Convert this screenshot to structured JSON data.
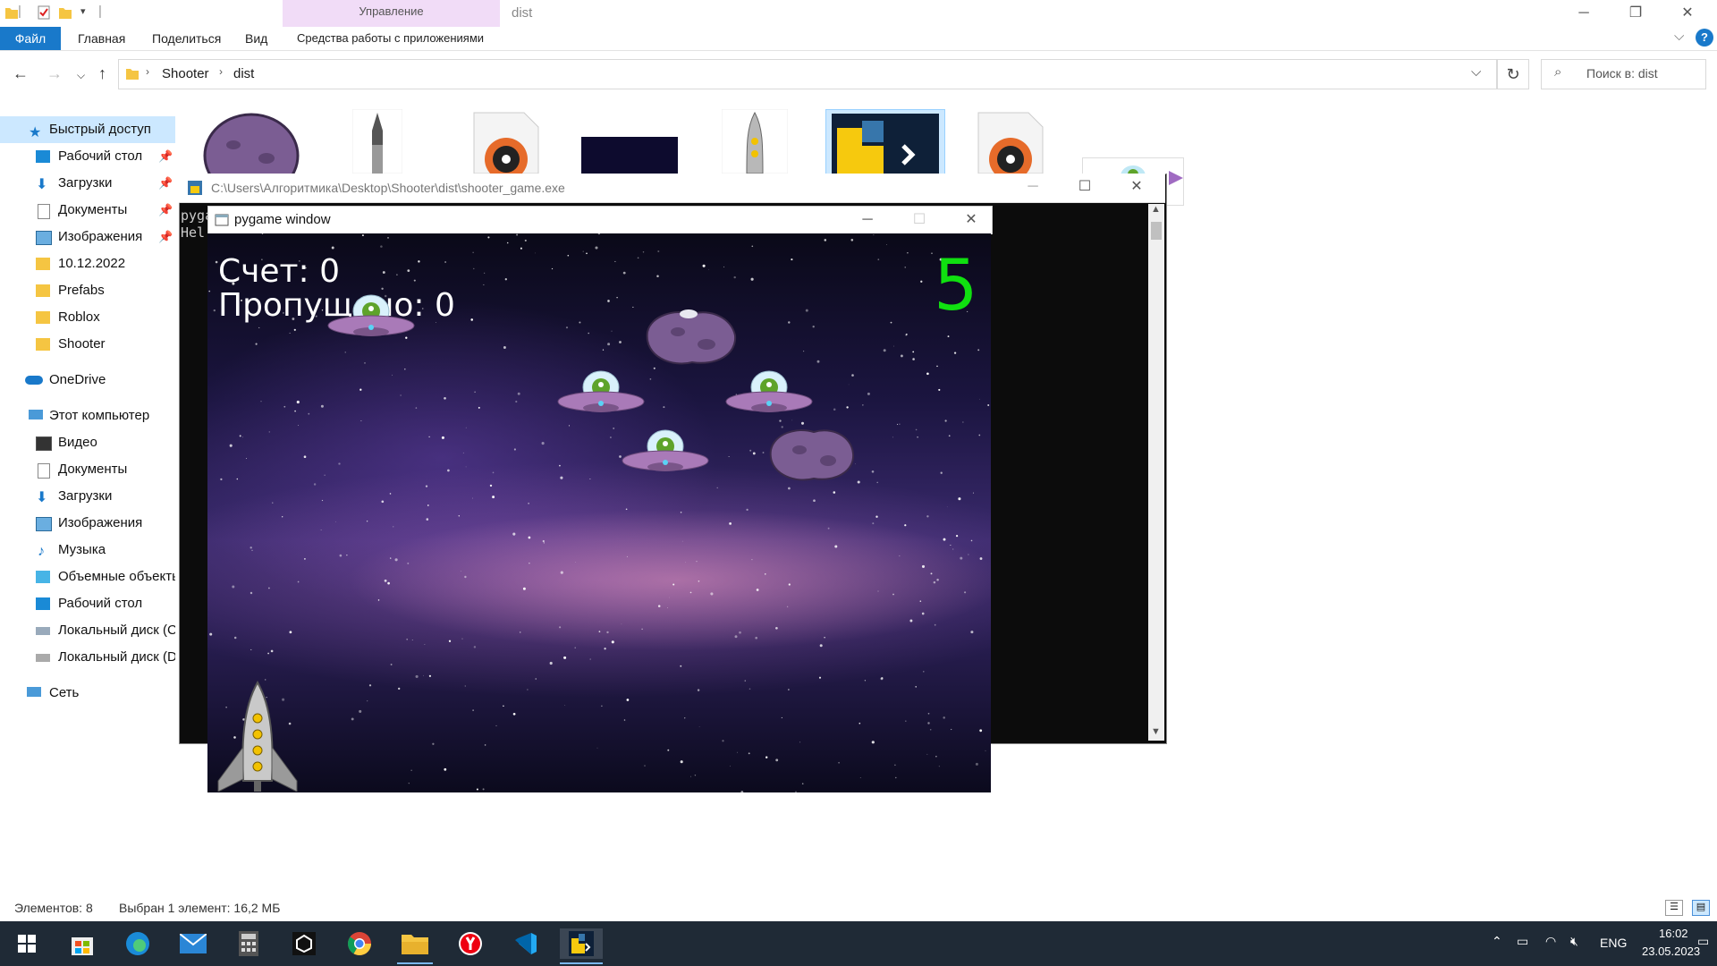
{
  "explorer": {
    "window_title": "dist",
    "ribbon": {
      "file_tab": "Файл",
      "tabs": [
        "Главная",
        "Поделиться",
        "Вид"
      ],
      "manage_group": "Управление",
      "manage_tab": "Средства работы с приложениями"
    },
    "breadcrumb": [
      "Shooter",
      "dist"
    ],
    "search_placeholder": "Поиск в: dist",
    "nav": {
      "quick_access": "Быстрый доступ",
      "quick_items": [
        "Рабочий стол",
        "Загрузки",
        "Документы",
        "Изображения",
        "10.12.2022",
        "Prefabs",
        "Roblox",
        "Shooter"
      ],
      "onedrive": "OneDrive",
      "this_pc": "Этот компьютер",
      "pc_items": [
        "Видео",
        "Документы",
        "Загрузки",
        "Изображения",
        "Музыка",
        "Объемные объекты",
        "Рабочий стол",
        "Локальный диск (C:)",
        "Локальный диск (D:)"
      ],
      "network": "Сеть"
    },
    "status": {
      "items_count": "Элементов: 8",
      "selected": "Выбран 1 элемент: 16,2 МБ"
    }
  },
  "console": {
    "title": "C:\\Users\\Алгоритмика\\Desktop\\Shooter\\dist\\shooter_game.exe",
    "lines": [
      "pyga",
      "Hel"
    ]
  },
  "pygame": {
    "title": "pygame window",
    "score_text": "Счет: 0",
    "missed_text": "Пропущено: 0",
    "lives": "5"
  },
  "taskbar": {
    "language": "ENG",
    "time": "16:02",
    "date": "23.05.2023"
  },
  "colors": {
    "ribbon_file_tab": "#1979ca",
    "manage_band": "#f1dcf7",
    "quick_access_highlight": "#cce8ff",
    "lives_green": "#10e010",
    "taskbar": "#1f2a36"
  }
}
